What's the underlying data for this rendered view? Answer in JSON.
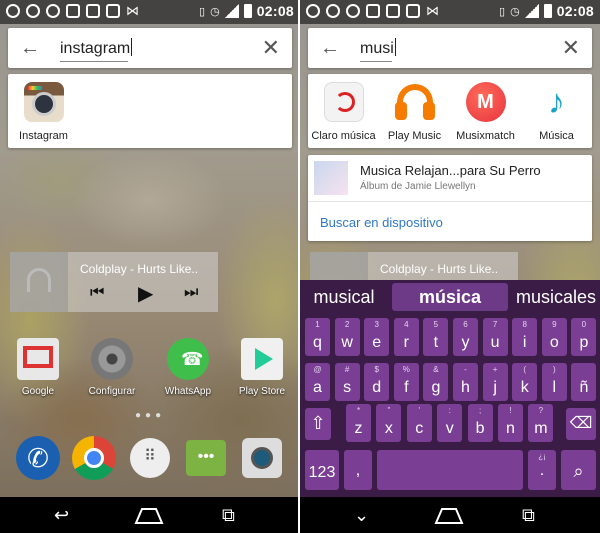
{
  "status": {
    "time": "02:08"
  },
  "left": {
    "search": {
      "query": "instagram"
    },
    "results": [
      {
        "label": "Instagram",
        "icon": "instagram-icon"
      }
    ],
    "widget": {
      "title": "Coldplay - Hurts Like.."
    },
    "home_apps": [
      {
        "label": "Google",
        "icon": "gmail-icon"
      },
      {
        "label": "Configurar",
        "icon": "settings-icon"
      },
      {
        "label": "WhatsApp",
        "icon": "whatsapp-icon"
      },
      {
        "label": "Play Store",
        "icon": "play-store-icon"
      }
    ],
    "dock": [
      "phone-icon",
      "chrome-icon",
      "apps-drawer-icon",
      "messaging-icon",
      "camera-icon"
    ]
  },
  "right": {
    "search": {
      "query": "musi"
    },
    "apps": [
      {
        "label": "Claro música",
        "icon": "claro-musica-icon"
      },
      {
        "label": "Play Music",
        "icon": "play-music-icon"
      },
      {
        "label": "Musixmatch",
        "icon": "musixmatch-icon"
      },
      {
        "label": "Música",
        "icon": "music-note-icon"
      }
    ],
    "album_result": {
      "title": "Musica Relajan...para Su Perro",
      "subtitle": "Álbum de Jamie Llewellyn"
    },
    "device_search_label": "Buscar en dispositivo",
    "widget": {
      "title": "Coldplay - Hurts Like.."
    },
    "keyboard": {
      "suggestions": [
        "musical",
        "música",
        "musicales"
      ],
      "row1": [
        {
          "m": "q",
          "h": "1"
        },
        {
          "m": "w",
          "h": "2"
        },
        {
          "m": "e",
          "h": "3"
        },
        {
          "m": "r",
          "h": "4"
        },
        {
          "m": "t",
          "h": "5"
        },
        {
          "m": "y",
          "h": "6"
        },
        {
          "m": "u",
          "h": "7"
        },
        {
          "m": "i",
          "h": "8"
        },
        {
          "m": "o",
          "h": "9"
        },
        {
          "m": "p",
          "h": "0"
        }
      ],
      "row2": [
        {
          "m": "a",
          "h": "@"
        },
        {
          "m": "s",
          "h": "#"
        },
        {
          "m": "d",
          "h": "$"
        },
        {
          "m": "f",
          "h": "%"
        },
        {
          "m": "g",
          "h": "&"
        },
        {
          "m": "h",
          "h": "-"
        },
        {
          "m": "j",
          "h": "+"
        },
        {
          "m": "k",
          "h": "("
        },
        {
          "m": "l",
          "h": ")"
        },
        {
          "m": "ñ",
          "h": ""
        }
      ],
      "row3": [
        {
          "m": "z",
          "h": "*"
        },
        {
          "m": "x",
          "h": "\""
        },
        {
          "m": "c",
          "h": "'"
        },
        {
          "m": "v",
          "h": ":"
        },
        {
          "m": "b",
          "h": ";"
        },
        {
          "m": "n",
          "h": "!"
        },
        {
          "m": "m",
          "h": "?"
        }
      ],
      "symbols_label": "123",
      "comma_label": ",",
      "period_label": ".",
      "punct_hint": "¿¡"
    }
  }
}
